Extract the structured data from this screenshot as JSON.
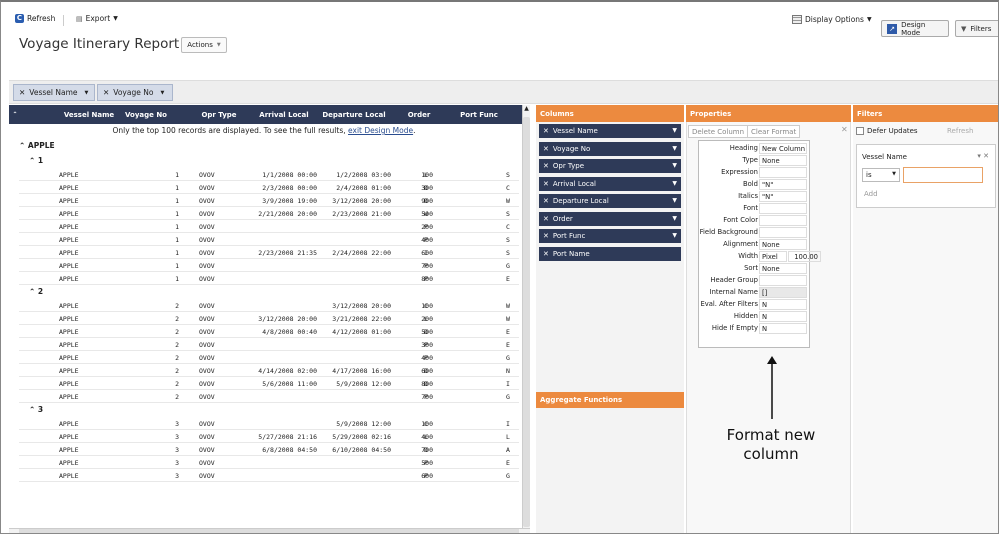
{
  "toolbar": {
    "refresh": "Refresh",
    "export": "Export",
    "display_options": "Display Options",
    "design_mode": "Design Mode",
    "filters": "Filters"
  },
  "page": {
    "title": "Voyage Itinerary Report",
    "actions": "Actions"
  },
  "group_chips": [
    {
      "label": "Vessel Name"
    },
    {
      "label": "Voyage No"
    }
  ],
  "grid": {
    "columns": [
      "Vessel Name",
      "Voyage No",
      "Opr Type",
      "Arrival Local",
      "Departure Local",
      "Order",
      "Port Func"
    ],
    "notice_text": "Only the top 100 records are displayed. To see the full results,",
    "notice_link": "exit Design Mode",
    "notice_end": ".",
    "vessel_group": "APPLE",
    "groups": [
      {
        "label": "1",
        "rows": [
          [
            "APPLE",
            "1",
            "OVOV",
            "1/1/2008 00:00",
            "1/2/2008 03:00",
            "100",
            "L",
            "S"
          ],
          [
            "APPLE",
            "1",
            "OVOV",
            "2/3/2008 00:00",
            "2/4/2008 01:00",
            "300",
            "D",
            "C"
          ],
          [
            "APPLE",
            "1",
            "OVOV",
            "3/9/2008 19:00",
            "3/12/2008 20:00",
            "900",
            "D",
            "W"
          ],
          [
            "APPLE",
            "1",
            "OVOV",
            "2/21/2008 20:00",
            "2/23/2008 21:00",
            "500",
            "W",
            "S"
          ],
          [
            "APPLE",
            "1",
            "OVOV",
            "",
            "",
            "200",
            "P",
            "C"
          ],
          [
            "APPLE",
            "1",
            "OVOV",
            "",
            "",
            "400",
            "P",
            "S"
          ],
          [
            "APPLE",
            "1",
            "OVOV",
            "2/23/2008 21:35",
            "2/24/2008 22:00",
            "600",
            "I",
            "S"
          ],
          [
            "APPLE",
            "1",
            "OVOV",
            "",
            "",
            "700",
            "P",
            "G"
          ],
          [
            "APPLE",
            "1",
            "OVOV",
            "",
            "",
            "800",
            "P",
            "E"
          ]
        ]
      },
      {
        "label": "2",
        "rows": [
          [
            "APPLE",
            "2",
            "OVOV",
            "",
            "3/12/2008 20:00",
            "100",
            "C",
            "W"
          ],
          [
            "APPLE",
            "2",
            "OVOV",
            "3/12/2008 20:00",
            "3/21/2008 22:00",
            "200",
            "L",
            "W"
          ],
          [
            "APPLE",
            "2",
            "OVOV",
            "4/8/2008 00:40",
            "4/12/2008 01:00",
            "500",
            "D",
            "E"
          ],
          [
            "APPLE",
            "2",
            "OVOV",
            "",
            "",
            "300",
            "P",
            "E"
          ],
          [
            "APPLE",
            "2",
            "OVOV",
            "",
            "",
            "400",
            "P",
            "G"
          ],
          [
            "APPLE",
            "2",
            "OVOV",
            "4/14/2008 02:00",
            "4/17/2008 16:00",
            "600",
            "D",
            "N"
          ],
          [
            "APPLE",
            "2",
            "OVOV",
            "5/6/2008 11:00",
            "5/9/2008 12:00",
            "800",
            "D",
            "I"
          ],
          [
            "APPLE",
            "2",
            "OVOV",
            "",
            "",
            "700",
            "P",
            "G"
          ]
        ]
      },
      {
        "label": "3",
        "rows": [
          [
            "APPLE",
            "3",
            "OVOV",
            "",
            "5/9/2008 12:00",
            "100",
            "C",
            "I"
          ],
          [
            "APPLE",
            "3",
            "OVOV",
            "5/27/2008 21:16",
            "5/29/2008 02:16",
            "400",
            "L",
            "L"
          ],
          [
            "APPLE",
            "3",
            "OVOV",
            "6/8/2008 04:50",
            "6/10/2008 04:50",
            "700",
            "D",
            "A"
          ],
          [
            "APPLE",
            "3",
            "OVOV",
            "",
            "",
            "500",
            "P",
            "E"
          ],
          [
            "APPLE",
            "3",
            "OVOV",
            "",
            "",
            "600",
            "P",
            "G"
          ]
        ]
      }
    ]
  },
  "columns_panel": {
    "title": "Columns",
    "items": [
      "Vessel Name",
      "Voyage No",
      "Opr Type",
      "Arrival Local",
      "Departure Local",
      "Order",
      "Port Func",
      "Port Name"
    ],
    "aggregate_title": "Aggregate Functions"
  },
  "properties_panel": {
    "title": "Properties",
    "delete_column": "Delete Column",
    "clear_format": "Clear Format",
    "rows": [
      {
        "label": "Heading",
        "value": "New Column"
      },
      {
        "label": "Type",
        "value": "None"
      },
      {
        "label": "Expression",
        "value": ""
      },
      {
        "label": "Bold",
        "value": "\"N\""
      },
      {
        "label": "Italics",
        "value": "\"N\""
      },
      {
        "label": "Font",
        "value": ""
      },
      {
        "label": "Font Color",
        "value": ""
      },
      {
        "label": "Field Background",
        "value": ""
      },
      {
        "label": "Alignment",
        "value": "None"
      },
      {
        "label": "Width",
        "value": "Pixel",
        "value2": "100.00"
      },
      {
        "label": "Sort",
        "value": "None"
      },
      {
        "label": "Header Group",
        "value": ""
      },
      {
        "label": "Internal Name",
        "value": "[]"
      },
      {
        "label": "Eval. After Filters",
        "value": "N"
      },
      {
        "label": "Hidden",
        "value": "N"
      },
      {
        "label": "Hide If Empty",
        "value": "N"
      }
    ],
    "annotation": "Format new column"
  },
  "filters_panel": {
    "title": "Filters",
    "defer_updates": "Defer Updates",
    "refresh": "Refresh",
    "field": "Vessel Name",
    "operator": "is",
    "add": "Add"
  },
  "colors": {
    "header_navy": "#2e3a58",
    "accent_orange": "#ec8a3f",
    "link_blue": "#2a4d8f"
  }
}
